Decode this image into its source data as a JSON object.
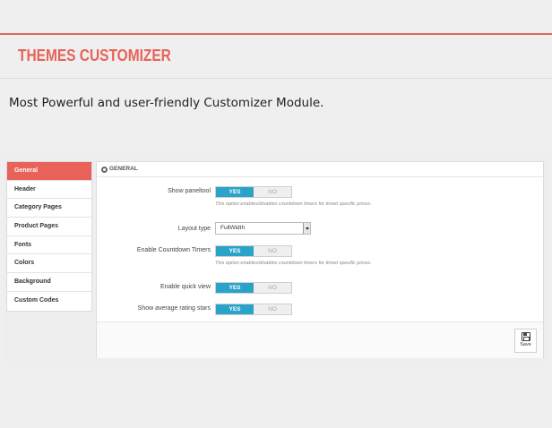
{
  "banner": {
    "title": "THEMES CUSTOMIZER",
    "tagline": "Most Powerful and user-friendly Customizer Module."
  },
  "colors": {
    "accent": "#e8625a",
    "toggle_on": "#2aa3c9"
  },
  "sidebar": {
    "items": [
      {
        "label": "General",
        "active": true
      },
      {
        "label": "Header"
      },
      {
        "label": "Category Pages"
      },
      {
        "label": "Product Pages"
      },
      {
        "label": "Fonts"
      },
      {
        "label": "Colors"
      },
      {
        "label": "Background"
      },
      {
        "label": "Custom Codes"
      }
    ]
  },
  "panel": {
    "header_icon": "gear-icon",
    "header_title": "GENERAL",
    "fields": {
      "show_paneltool": {
        "label": "Show paneltool",
        "yes": "YES",
        "no": "NO",
        "value": "YES",
        "help": "This option enables/disables countdown timers for timed specific prices."
      },
      "layout_type": {
        "label": "Layout type",
        "value": "FullWidth"
      },
      "countdown": {
        "label": "Enable Countdown Timers",
        "yes": "YES",
        "no": "NO",
        "value": "YES",
        "help": "This option enables/disables countdown timers for timed specific prices."
      },
      "quick_view": {
        "label": "Enable quick view",
        "yes": "YES",
        "no": "NO",
        "value": "YES"
      },
      "rating_stars": {
        "label": "Show average rating stars",
        "yes": "YES",
        "no": "NO",
        "value": "YES"
      }
    },
    "save": {
      "icon": "save-icon",
      "label": "Save"
    }
  }
}
